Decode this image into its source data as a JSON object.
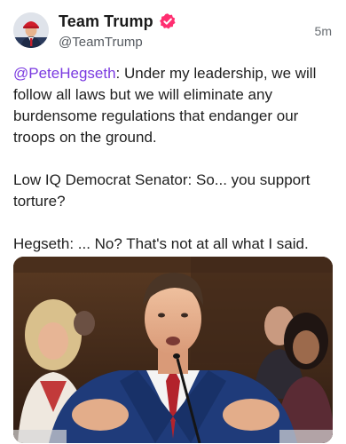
{
  "post": {
    "author": {
      "display_name": "Team Trump",
      "handle": "@TeamTrump",
      "verified": true,
      "verified_color": "#ff2e70"
    },
    "timestamp": "5m",
    "body": {
      "mention": "@PeteHegseth",
      "line1_rest": ": Under my leadership, we will follow all laws but we will eliminate any burdensome regulations that endanger our troops on the ground.",
      "line2": "Low IQ Democrat Senator: So... you support torture?",
      "line3": "Hegseth: ... No? That's not at all what I said."
    },
    "mention_color": "#7a3ae0",
    "media": {
      "type": "image",
      "icon": "photo-of-hearing"
    }
  }
}
